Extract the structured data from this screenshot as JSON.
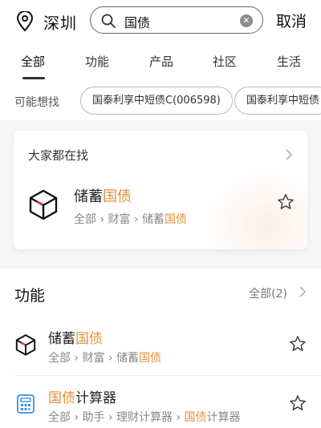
{
  "header": {
    "city": "深圳",
    "search_value": "国债",
    "cancel_label": "取消"
  },
  "tabs": [
    {
      "label": "全部",
      "active": true
    },
    {
      "label": "功能"
    },
    {
      "label": "产品"
    },
    {
      "label": "社区"
    },
    {
      "label": "生活"
    }
  ],
  "suggest": {
    "label": "可能想找",
    "chips": [
      "国泰利享中短债C(006598)",
      "国泰利享中短债"
    ]
  },
  "popular": {
    "heading": "大家都在找",
    "item": {
      "title_plain": "储蓄",
      "title_hl": "国债",
      "path_parts": [
        "全部",
        "财富",
        "储蓄"
      ],
      "path_hl": "国债"
    }
  },
  "functions": {
    "title": "功能",
    "all_label": "全部(2)",
    "items": [
      {
        "title_plain": "储蓄",
        "title_hl": "国债",
        "path": "全部 › 财富 › 储蓄",
        "path_hl": "国债",
        "icon": "cube-icon"
      },
      {
        "title_hl": "国债",
        "title_plain": "计算器",
        "path": "全部 › 助手 › 理财计算器 › ",
        "path_hl": "国债",
        "path_tail": "计算器",
        "icon": "calculator-icon"
      }
    ]
  },
  "colors": {
    "highlight": "#e0913a",
    "accent_blue": "#3d8fe0",
    "cube_red": "#e03a3a"
  }
}
